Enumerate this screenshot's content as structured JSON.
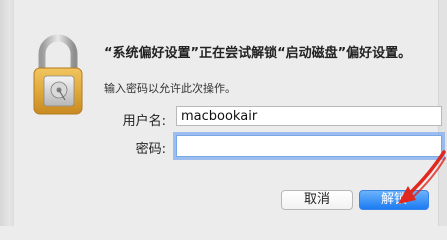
{
  "dialog": {
    "title": "“系统偏好设置”正在尝试解锁“启动磁盘”偏好设置。",
    "subtitle": "输入密码以允许此次操作。",
    "username_label": "用户名:",
    "username_value": "macbookair",
    "password_label": "密码:",
    "password_value": "",
    "cancel_label": "取消",
    "unlock_label": "解锁"
  },
  "icons": {
    "lock": "padlock-with-disk-icon",
    "annotation": "red-arrow-annotation"
  },
  "colors": {
    "lock_gold": "#e0a93b",
    "focus_ring": "#71a4f1",
    "default_button": "#1b7bf3",
    "annotation_red": "#e0281f"
  }
}
